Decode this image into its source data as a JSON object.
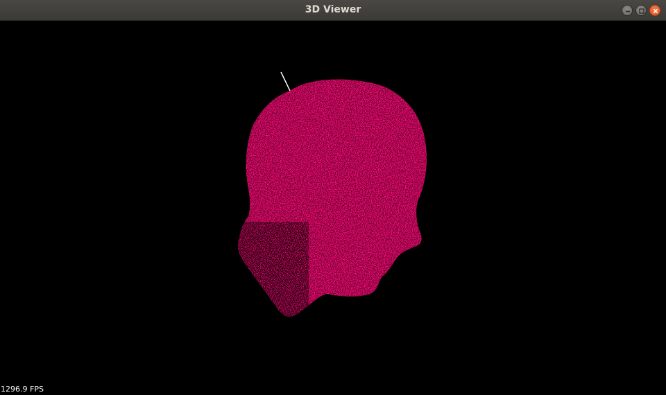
{
  "window": {
    "title": "3D Viewer",
    "controls": [
      "minimize-icon",
      "maximize-icon",
      "close-icon"
    ]
  },
  "viewport": {
    "background_color": "#000000",
    "point_cloud_color": "#ff0a78",
    "point_cloud_shape": "human-head-profile",
    "axis_indicator_color": "#ffffff"
  },
  "status": {
    "fps_text": "1296.9 FPS"
  }
}
